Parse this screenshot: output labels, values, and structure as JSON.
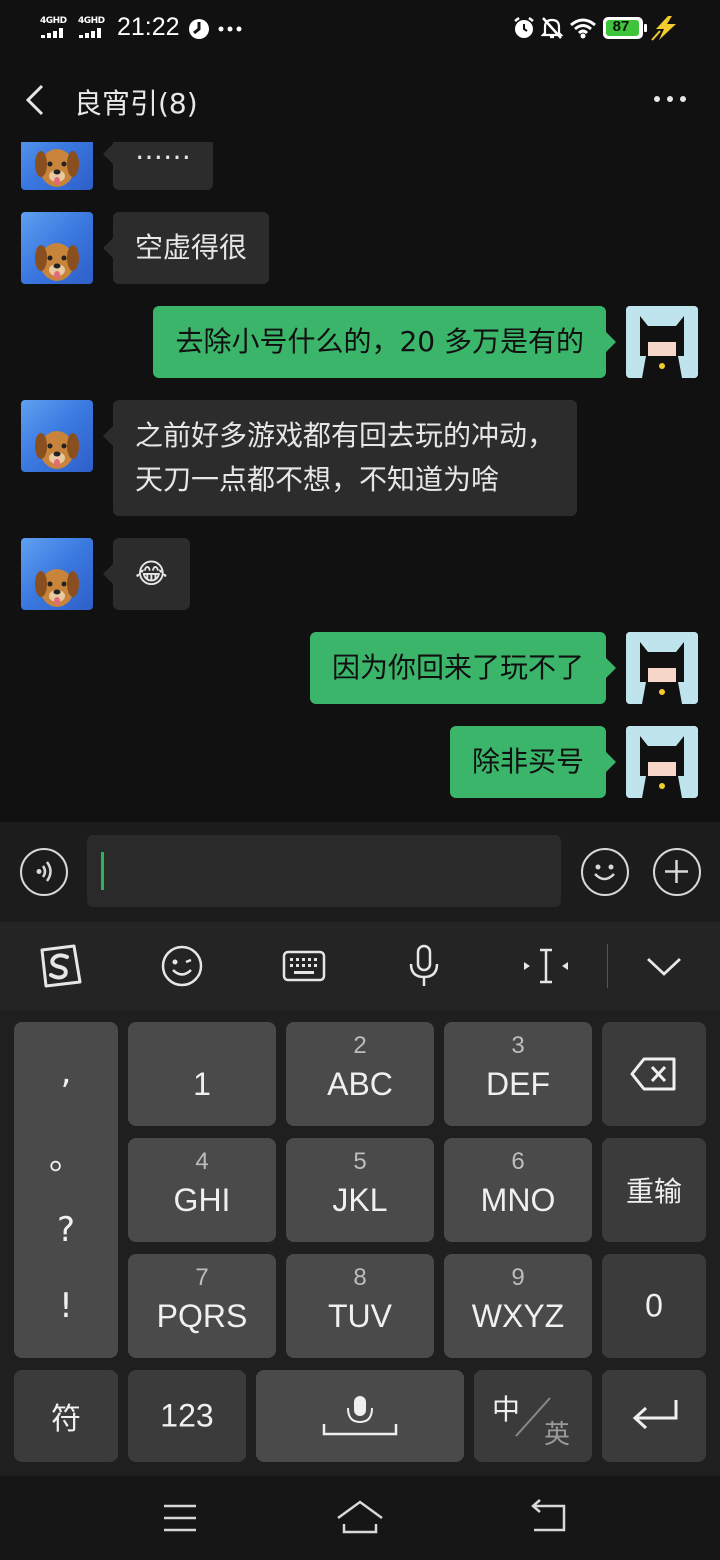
{
  "status_bar": {
    "time": "21:22",
    "signal1": "4GHD",
    "signal2": "4GHD",
    "battery": "87",
    "icons": [
      "data-saver-icon",
      "more-dots-icon",
      "alarm-icon",
      "mute-icon",
      "wifi-icon",
      "battery-icon",
      "charging-icon"
    ]
  },
  "header": {
    "title": "良宵引(8)",
    "back_icon": "chevron-left-icon",
    "more_icon": "more-dots-icon"
  },
  "messages": [
    {
      "side": "in",
      "text": "……"
    },
    {
      "side": "in",
      "text": "空虚得很"
    },
    {
      "side": "out",
      "text": "去除小号什么的，20 多万是有的"
    },
    {
      "side": "in",
      "text": "之前好多游戏都有回去玩的冲动，\n天刀一点都不想，不知道为啥"
    },
    {
      "side": "in",
      "text": "😂"
    },
    {
      "side": "out",
      "text": "因为你回来了玩不了"
    },
    {
      "side": "out",
      "text": "除非买号"
    }
  ],
  "input_bar": {
    "voice_icon": "voice-icon",
    "placeholder": "",
    "value": "",
    "emoji_icon": "emoji-icon",
    "add_icon": "plus-icon"
  },
  "keyboard_toolbar": {
    "items": [
      "sogou-logo-icon",
      "emoji-icon",
      "keyboard-icon",
      "microphone-icon",
      "cursor-move-icon",
      "collapse-keyboard-icon"
    ]
  },
  "keyboard": {
    "punct": [
      ",",
      "。",
      "?",
      "!"
    ],
    "rows": [
      [
        {
          "num": "",
          "label": "1"
        },
        {
          "num": "2",
          "label": "ABC"
        },
        {
          "num": "3",
          "label": "DEF"
        }
      ],
      [
        {
          "num": "4",
          "label": "GHI"
        },
        {
          "num": "5",
          "label": "JKL"
        },
        {
          "num": "6",
          "label": "MNO"
        }
      ],
      [
        {
          "num": "7",
          "label": "PQRS"
        },
        {
          "num": "8",
          "label": "TUV"
        },
        {
          "num": "9",
          "label": "WXYZ"
        }
      ]
    ],
    "reenter": "重输",
    "zero": "0",
    "symbol": "符",
    "num123": "123",
    "lang_zh": "中",
    "lang_en": "英"
  },
  "nav_bar": {
    "items": [
      "menu-icon",
      "home-icon",
      "back-icon"
    ]
  },
  "colors": {
    "background": "#111111",
    "outgoing_bubble": "#3ab56a",
    "incoming_bubble": "#2c2c2c",
    "caret": "#2bb45f"
  }
}
